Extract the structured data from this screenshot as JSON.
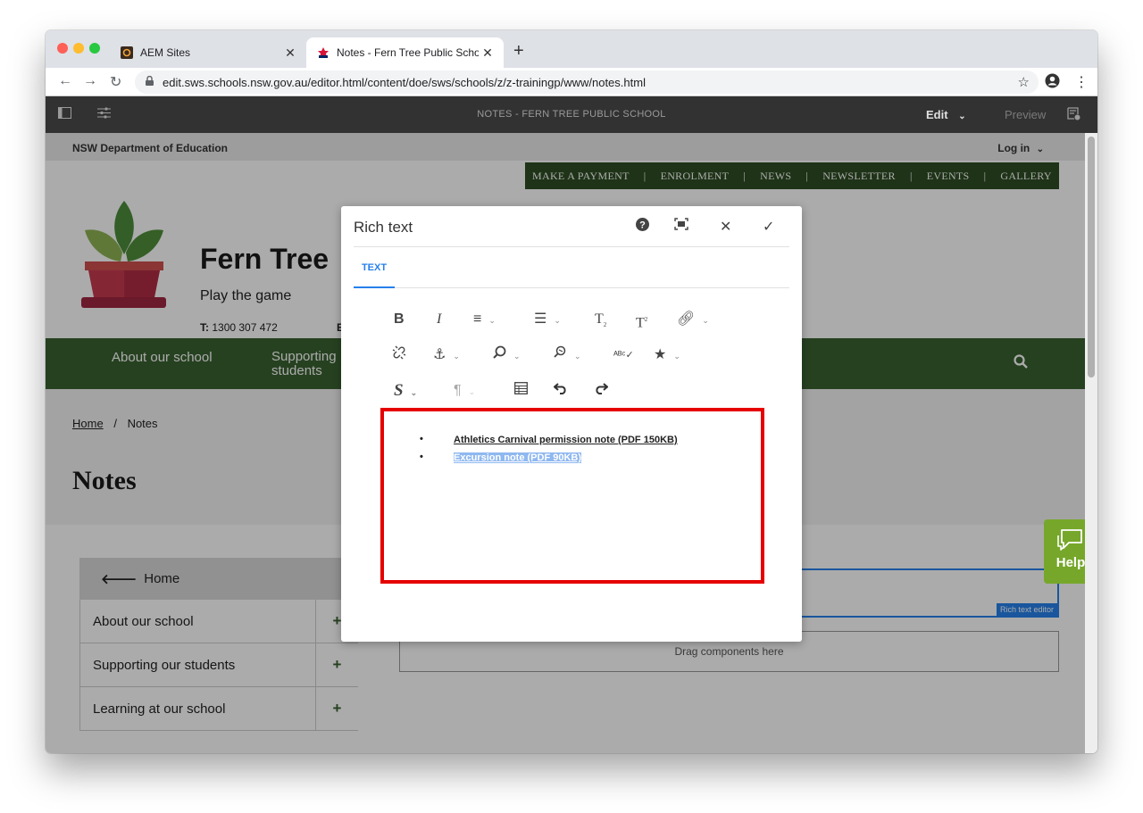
{
  "browser": {
    "tabs": [
      {
        "title": "AEM Sites",
        "close": "✕"
      },
      {
        "title": "Notes - Fern Tree Public Schoo",
        "close": "✕"
      }
    ],
    "new_tab": "+",
    "url": "edit.sws.schools.nsw.gov.au/editor.html/content/doe/sws/schools/z/z-trainingp/www/notes.html"
  },
  "aem_bar": {
    "title": "NOTES - FERN TREE PUBLIC SCHOOL",
    "edit_label": "Edit",
    "preview_label": "Preview"
  },
  "site": {
    "department": "NSW Department of Education",
    "login": "Log in",
    "top_links": [
      "MAKE A PAYMENT",
      "ENROLMENT",
      "NEWS",
      "NEWSLETTER",
      "EVENTS",
      "GALLERY"
    ],
    "school_name": "Fern Tree",
    "motto": "Play the game",
    "phone_label": "T:",
    "phone": "1300 307 472",
    "email_initial": "E",
    "main_nav": [
      "About our school",
      "Supporting students"
    ],
    "breadcrumb_home": "Home",
    "breadcrumb_sep": "/",
    "breadcrumb_current": "Notes",
    "page_title": "Notes",
    "sidebar_home": "Home",
    "sidebar_items": [
      "About our school",
      "Supporting our students",
      "Learning at our school"
    ],
    "rte_tag": "Rich text editor",
    "dropzone": "Drag components here",
    "help": "Help"
  },
  "dialog": {
    "title": "Rich text",
    "tab": "TEXT",
    "items": [
      {
        "text": "Athletics Carnival permission note (PDF 150KB)",
        "selected": false
      },
      {
        "text": "Excursion note (PDF 90KB)",
        "selected": true
      }
    ]
  }
}
